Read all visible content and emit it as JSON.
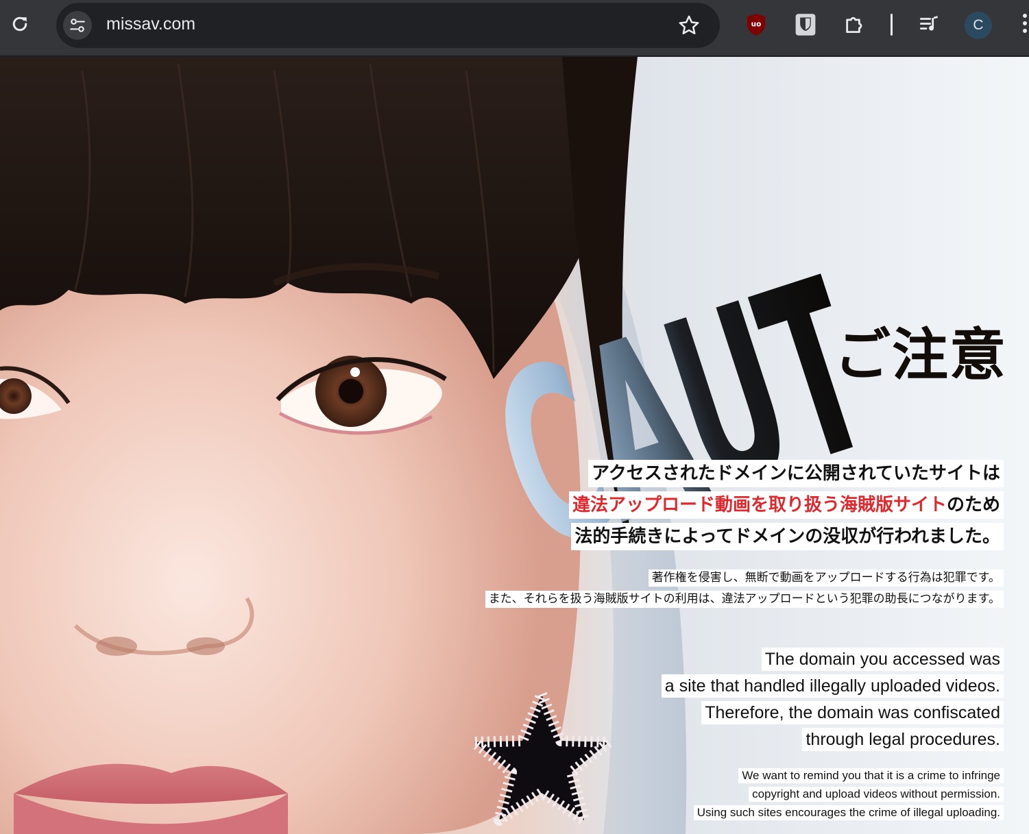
{
  "browser": {
    "url": "missav.com",
    "profile_initial": "C"
  },
  "notice": {
    "headline": "CAUTION!",
    "headline_jp": "ご注意",
    "jp_main": {
      "line1": "アクセスされたドメインに公開されていたサイトは",
      "line2_red": "違法アップロード動画を取り扱う海賊版サイト",
      "line2_rest": "のため",
      "line3": "法的手続きによってドメインの没収が行われました。"
    },
    "jp_sub": [
      "著作権を侵害し、無断で動画をアップロードする行為は犯罪です。",
      "また、それらを扱う海賊版サイトの利用は、違法アップロードという犯罪の助長につながります。"
    ],
    "en_main": [
      "The domain you accessed was",
      "a site that handled illegally uploaded videos.",
      "Therefore, the domain was confiscated",
      "through legal procedures."
    ],
    "en_sub": [
      "We want to remind you that it is a crime to infringe",
      "copyright and upload videos without permission.",
      "Using such sites encourages the crime of illegal uploading."
    ]
  },
  "icons": {
    "reload": "reload-icon",
    "site_info": "site-settings-icon",
    "bookmark": "star-icon",
    "ublock": "ublock-origin-icon",
    "bitwarden": "bitwarden-shield-icon",
    "extensions": "puzzle-icon",
    "media": "media-queue-icon",
    "menu": "kebab-menu-icon"
  },
  "colors": {
    "chrome": "#35363a",
    "omnibox": "#202124",
    "alert_red": "#e0282c"
  }
}
